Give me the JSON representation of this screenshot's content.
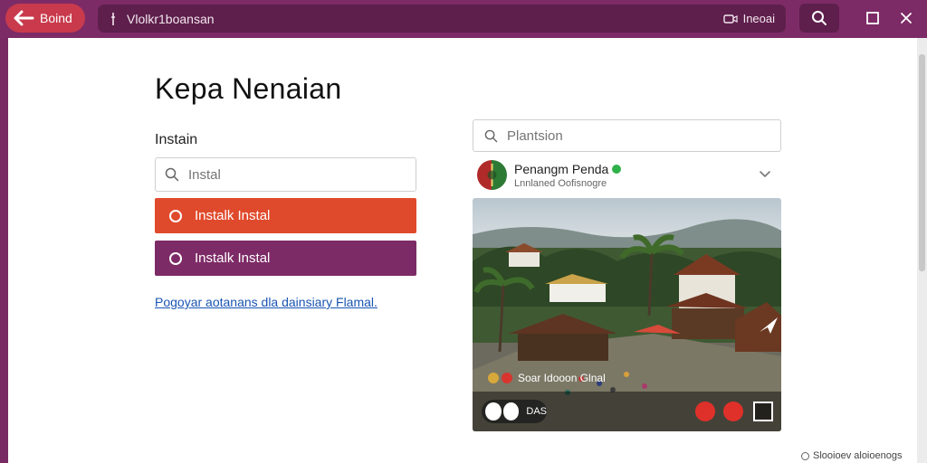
{
  "titlebar": {
    "back_label": "Boind",
    "url": "Vlolkr1boansan",
    "url_right": "Ineoai",
    "colors": {
      "bar": "#7d2b66",
      "back": "#c83a4c",
      "field": "#5e1f4c"
    }
  },
  "page": {
    "title": "Kepa Nenaian",
    "section_label": "Instain",
    "search_placeholder": "Instal",
    "buttons": [
      {
        "label": "Instalk Instal",
        "color": "#e04a2c",
        "icon": "ring-icon"
      },
      {
        "label": "Instalk Instal",
        "color": "#7d2b66",
        "icon": "ring-icon"
      }
    ],
    "link": "Pogoyar aotanans dla dainsiary Flamal."
  },
  "right_panel": {
    "search_placeholder": "Plantsion",
    "profile": {
      "name": "Penangm Penda",
      "subtitle": "Lnnlaned Oofisnogre"
    },
    "photo": {
      "caption": "Soar Idooon Glnal",
      "ctrl_text": "DAS"
    }
  },
  "footer": {
    "note": "Slooioev aloioenogs"
  }
}
